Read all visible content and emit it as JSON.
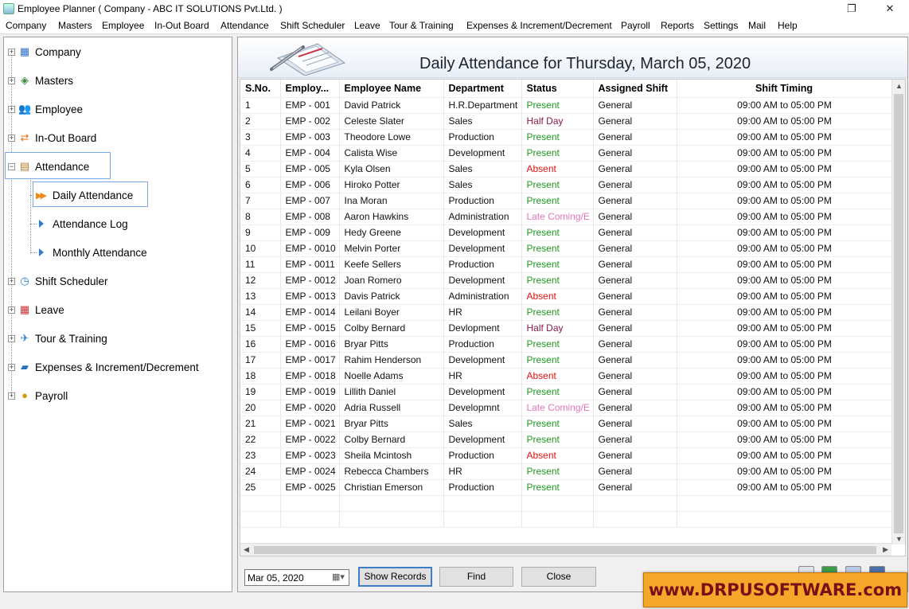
{
  "window": {
    "title": "Employee Planner ( Company - ABC IT SOLUTIONS Pvt.Ltd. )",
    "restore_glyph": "❐",
    "close_glyph": "✕"
  },
  "menu": [
    "Company",
    "Masters",
    "Employee",
    "In-Out Board",
    "Attendance",
    "Shift Scheduler",
    "Leave",
    "Tour & Training",
    "Expenses & Increment/Decrement",
    "Payroll",
    "Reports",
    "Settings",
    "Mail",
    "Help"
  ],
  "tree": {
    "company": "Company",
    "masters": "Masters",
    "employee": "Employee",
    "inout": "In-Out Board",
    "attendance": "Attendance",
    "daily": "Daily Attendance",
    "log": "Attendance Log",
    "monthly": "Monthly Attendance",
    "shift": "Shift Scheduler",
    "leave": "Leave",
    "tour": "Tour & Training",
    "expenses": "Expenses & Increment/Decrement",
    "payroll": "Payroll"
  },
  "page": {
    "title": "Daily Attendance for Thursday, March 05, 2020"
  },
  "grid": {
    "headers": [
      "S.No.",
      "Employ...",
      "Employee Name",
      "Department",
      "Status",
      "Assigned Shift",
      "Shift Timing"
    ],
    "rows": [
      [
        "1",
        "EMP - 001",
        "David Patrick",
        "H.R.Department",
        "Present",
        "General",
        "09:00 AM to 05:00 PM"
      ],
      [
        "2",
        "EMP - 002",
        "Celeste Slater",
        "Sales",
        "Half Day",
        "General",
        "09:00 AM to 05:00 PM"
      ],
      [
        "3",
        "EMP - 003",
        "Theodore Lowe",
        "Production",
        "Present",
        "General",
        "09:00 AM to 05:00 PM"
      ],
      [
        "4",
        "EMP - 004",
        "Calista Wise",
        "Development",
        "Present",
        "General",
        "09:00 AM to 05:00 PM"
      ],
      [
        "5",
        "EMP - 005",
        "Kyla Olsen",
        "Sales",
        "Absent",
        "General",
        "09:00 AM to 05:00 PM"
      ],
      [
        "6",
        "EMP - 006",
        "Hiroko Potter",
        "Sales",
        "Present",
        "General",
        "09:00 AM to 05:00 PM"
      ],
      [
        "7",
        "EMP - 007",
        "Ina Moran",
        "Production",
        "Present",
        "General",
        "09:00 AM to 05:00 PM"
      ],
      [
        "8",
        "EMP - 008",
        "Aaron Hawkins",
        "Administration",
        "Late Coming/E",
        "General",
        "09:00 AM to 05:00 PM"
      ],
      [
        "9",
        "EMP - 009",
        "Hedy Greene",
        "Development",
        "Present",
        "General",
        "09:00 AM to 05:00 PM"
      ],
      [
        "10",
        "EMP - 0010",
        "Melvin Porter",
        "Development",
        "Present",
        "General",
        "09:00 AM to 05:00 PM"
      ],
      [
        "11",
        "EMP - 0011",
        "Keefe Sellers",
        "Production",
        "Present",
        "General",
        "09:00 AM to 05:00 PM"
      ],
      [
        "12",
        "EMP - 0012",
        "Joan Romero",
        "Development",
        "Present",
        "General",
        "09:00 AM to 05:00 PM"
      ],
      [
        "13",
        "EMP - 0013",
        "Davis Patrick",
        "Administration",
        "Absent",
        "General",
        "09:00 AM to 05:00 PM"
      ],
      [
        "14",
        "EMP - 0014",
        "Leilani Boyer",
        "HR",
        "Present",
        "General",
        "09:00 AM to 05:00 PM"
      ],
      [
        "15",
        "EMP - 0015",
        "Colby Bernard",
        "Devlopment",
        "Half Day",
        "General",
        "09:00 AM to 05:00 PM"
      ],
      [
        "16",
        "EMP - 0016",
        "Bryar Pitts",
        "Production",
        "Present",
        "General",
        "09:00 AM to 05:00 PM"
      ],
      [
        "17",
        "EMP - 0017",
        "Rahim Henderson",
        "Development",
        "Present",
        "General",
        "09:00 AM to 05:00 PM"
      ],
      [
        "18",
        "EMP - 0018",
        "Noelle Adams",
        "HR",
        "Absent",
        "General",
        "09:00 AM to 05:00 PM"
      ],
      [
        "19",
        "EMP - 0019",
        "Lillith Daniel",
        "Development",
        "Present",
        "General",
        "09:00 AM to 05:00 PM"
      ],
      [
        "20",
        "EMP - 0020",
        "Adria Russell",
        "Developmnt",
        "Late Coming/E",
        "General",
        "09:00 AM to 05:00 PM"
      ],
      [
        "21",
        "EMP - 0021",
        "Bryar Pitts",
        "Sales",
        "Present",
        "General",
        "09:00 AM to 05:00 PM"
      ],
      [
        "22",
        "EMP - 0022",
        "Colby Bernard",
        "Development",
        "Present",
        "General",
        "09:00 AM to 05:00 PM"
      ],
      [
        "23",
        "EMP - 0023",
        "Sheila Mcintosh",
        "Production",
        "Absent",
        "General",
        "09:00 AM to 05:00 PM"
      ],
      [
        "24",
        "EMP - 0024",
        "Rebecca Chambers",
        "HR",
        "Present",
        "General",
        "09:00 AM to 05:00 PM"
      ],
      [
        "25",
        "EMP - 0025",
        "Christian Emerson",
        "Production",
        "Present",
        "General",
        "09:00 AM to 05:00 PM"
      ]
    ],
    "status_colors": {
      "Present": "#1e9a22",
      "Half Day": "#8a1a4a",
      "Absent": "#e01010",
      "Late Coming/E": "#e278bc"
    }
  },
  "controls": {
    "date_value": "Mar 05, 2020",
    "show_records": "Show Records",
    "find": "Find",
    "close": "Close"
  },
  "footer_icons": [
    "report-icon",
    "excel-icon",
    "print-icon",
    "help-icon"
  ],
  "brand": {
    "text": "www.DRPUSOFTWARE.com",
    "bg_color": "#f4a72a",
    "text_color": "#7a0f18"
  }
}
